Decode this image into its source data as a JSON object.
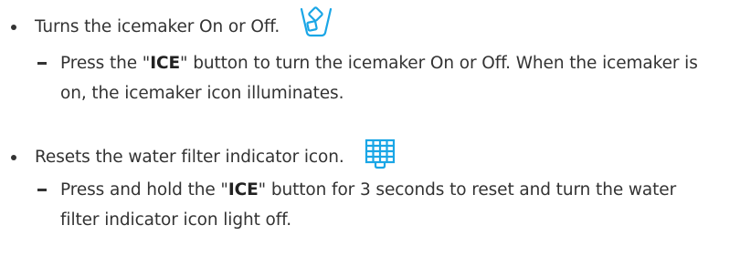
{
  "items": [
    {
      "summary": "Turns the icemaker On or Off.",
      "icon": "icemaker-icon",
      "detail": {
        "pre": "Press the \"",
        "button": "ICE",
        "post": "\" button to turn the icemaker On or Off. When the icemaker is on, the icemaker icon illuminates."
      }
    },
    {
      "summary": "Resets the water filter indicator icon.",
      "icon": "water-filter-icon",
      "detail": {
        "pre": "Press and hold the \"",
        "button": "ICE",
        "post": "\" button for 3 seconds to reset and turn the water filter indicator icon light off."
      }
    }
  ],
  "colors": {
    "text": "#333333",
    "icon_accent": "#1aa6e6"
  }
}
